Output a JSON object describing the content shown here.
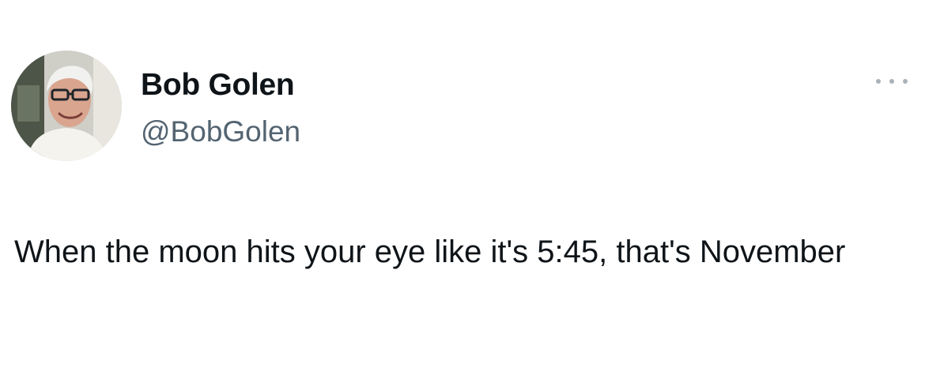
{
  "tweet": {
    "author": {
      "display_name": "Bob Golen",
      "handle": "@BobGolen",
      "avatar_icon": "profile-photo"
    },
    "more_icon": "more-horizontal-icon",
    "text": "When the moon hits your eye like it's 5:45, that's November"
  },
  "colors": {
    "background": "#ffffff",
    "primary_text": "#0f1419",
    "secondary_text": "#536471",
    "more_icon": "#aab2b9"
  }
}
